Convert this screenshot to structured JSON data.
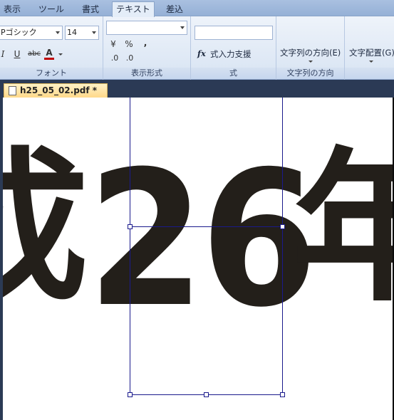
{
  "ribbon": {
    "tabs": [
      {
        "label": "表示"
      },
      {
        "label": "ツール"
      },
      {
        "label": "書式"
      },
      {
        "label": "テキスト"
      },
      {
        "label": "差込"
      }
    ],
    "active_tab": "テキスト",
    "font_group": {
      "font_name": "Pゴシック",
      "font_size": "14",
      "italic": "I",
      "underline": "U",
      "strikethrough": "abc",
      "font_color": "A",
      "label": "フォント"
    },
    "display_format_group": {
      "format_value": "",
      "yen": "¥",
      "percent": "%",
      "comma": ",",
      "decimal_increase": ".0",
      "decimal_decrease": ".0",
      "label": "表示形式"
    },
    "formula_group": {
      "input_value": "",
      "fx": "fx",
      "button_label": "式入力支援",
      "label": "式"
    },
    "text_direction_group": {
      "button_label": "文字列の方向(E)",
      "label": "文字列の方向"
    },
    "text_align_group": {
      "button_label": "文字配置(G)"
    }
  },
  "document": {
    "tab_label": "h25_05_02.pdf *",
    "canvas_text": {
      "left_fragment": "成",
      "number": "26",
      "right_fragment": "年"
    }
  },
  "colors": {
    "text_color": "#231f1a",
    "selection_color": "#1a1a8c",
    "doc_tab_bg": "#ffd98a"
  }
}
